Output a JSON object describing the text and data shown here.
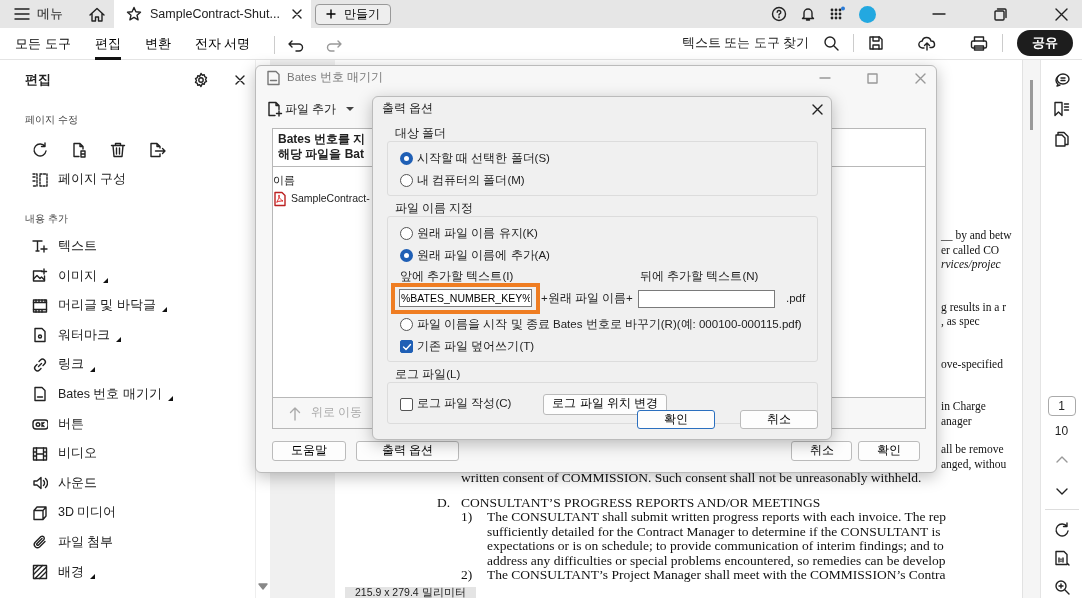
{
  "title_bar": {
    "menu_label": "메뉴",
    "tab": {
      "title": "SampleContract-Shut...",
      "selected": true
    },
    "new_button": "만들기"
  },
  "toolbar": {
    "menus": [
      {
        "label": "모든 도구",
        "selected": false
      },
      {
        "label": "편집",
        "selected": true
      },
      {
        "label": "변환",
        "selected": false
      },
      {
        "label": "전자 서명",
        "selected": false
      }
    ],
    "search_label": "텍스트 또는 도구 찾기",
    "share_button": "공유"
  },
  "side_panel": {
    "title": "편집",
    "page_heading": "페이지 수정",
    "organize_label": "페이지 구성",
    "content_heading": "내용 추가",
    "items": [
      {
        "label": "텍스트",
        "has_submenu": false
      },
      {
        "label": "이미지",
        "has_submenu": true
      },
      {
        "label": "머리글 및 바닥글",
        "has_submenu": true
      },
      {
        "label": "워터마크",
        "has_submenu": true
      },
      {
        "label": "링크",
        "has_submenu": true
      },
      {
        "label": "Bates 번호 매기기",
        "has_submenu": true
      },
      {
        "label": "버튼",
        "has_submenu": false
      },
      {
        "label": "비디오",
        "has_submenu": false
      },
      {
        "label": "사운드",
        "has_submenu": false
      },
      {
        "label": "3D 미디어",
        "has_submenu": false
      },
      {
        "label": "파일 첨부",
        "has_submenu": false
      },
      {
        "label": "배경",
        "has_submenu": true
      }
    ]
  },
  "document": {
    "fragments": [
      [
        {
          "text": "__ by and betw",
          "italic": false
        },
        {
          "text": "er called CO",
          "italic": false
        },
        {
          "text": "rvices/projec",
          "italic": true
        }
      ],
      [
        {
          "text": "g results in a r",
          "italic": false
        },
        {
          "text": ", as spec",
          "italic": false
        }
      ],
      [
        {
          "text": "ove-specified",
          "italic": false
        }
      ],
      [
        {
          "text": "in Charge",
          "italic": false
        },
        {
          "text": "anager",
          "italic": false
        }
      ],
      [
        {
          "text": "all be remove",
          "italic": false
        },
        {
          "text": "anged, withou",
          "italic": false
        }
      ]
    ],
    "lines": [
      {
        "kind": "cont",
        "text": "written consent of COMMISSION.  Such consent shall not be unreasonably withheld."
      },
      {
        "kind": "heading",
        "marker": "D.",
        "text": "CONSULTANT’S PROGRESS REPORTS AND/OR MEETINGS"
      },
      {
        "kind": "item",
        "marker": "1)",
        "text": "The CONSULTANT shall submit written progress reports with each invoice. The rep"
      },
      {
        "kind": "cont",
        "text": "sufficiently detailed for the Contract Manager to determine if the CONSULTANT is"
      },
      {
        "kind": "cont",
        "text": "expectations or is on schedule; to provide communication of interim findings; and to"
      },
      {
        "kind": "cont",
        "text": "address any difficulties or special problems encountered, so remedies can be develop"
      },
      {
        "kind": "item",
        "marker": "2)",
        "text": "The CONSULTANT’s Project Manager shall meet with the COMMISSION’s Contra"
      }
    ],
    "page_size": "215.9 x 279.4 밀리미터"
  },
  "right_rail": {
    "page_number": "1",
    "page_count": "10"
  },
  "bates_dialog": {
    "title": "Bates 번호 매기기",
    "add_files": "파일 추가",
    "instructions": [
      "Bates 번호를 지",
      "해당 파일을 Bat"
    ],
    "column": "이름",
    "files": [
      "SampleContract-"
    ],
    "move_up": {
      "label": "위로 이동",
      "disabled": true
    },
    "buttons": [
      "도움말",
      "출력 옵션",
      "취소",
      "확인"
    ]
  },
  "output_dialog": {
    "title": "출력 옵션",
    "groups": [
      {
        "label": "대상 폴더",
        "rows": [
          {
            "kind": "radio",
            "label": "시작할 때 선택한 폴더(S)",
            "selected": true
          },
          {
            "kind": "radio",
            "label": "내 컴퓨터의 폴더(M)",
            "selected": false
          }
        ]
      },
      {
        "label": "파일 이름 지정",
        "rows": [
          {
            "kind": "radio",
            "label": "원래 파일 이름 유지(K)",
            "selected": false
          },
          {
            "kind": "radio",
            "label": "원래 파일 이름에 추가(A)",
            "selected": true
          },
          {
            "kind": "affix",
            "prefix_label": "앞에 추가할 텍스트(I)",
            "prefix_value": "%BATES_NUMBER_KEY%",
            "joiner": "+원래 파일 이름+",
            "suffix_label": "뒤에 추가할 텍스트(N)",
            "extension": ".pdf",
            "highlighted": true
          },
          {
            "kind": "radio",
            "label": "파일 이름을 시작 및 종료 Bates 번호로 바꾸기(R)(예: 000100-000115.pdf)",
            "selected": false
          },
          {
            "kind": "checkbox",
            "label": "기존 파일 덮어쓰기(T)",
            "checked": true
          }
        ]
      },
      {
        "label": "로그 파일(L)",
        "rows": [
          {
            "kind": "checkbox",
            "label": "로그 파일 작성(C)",
            "checked": false,
            "button": "로그 파일 위치 변경"
          }
        ]
      }
    ],
    "buttons": [
      {
        "label": "확인",
        "default": true
      },
      {
        "label": "취소",
        "default": false
      }
    ]
  }
}
